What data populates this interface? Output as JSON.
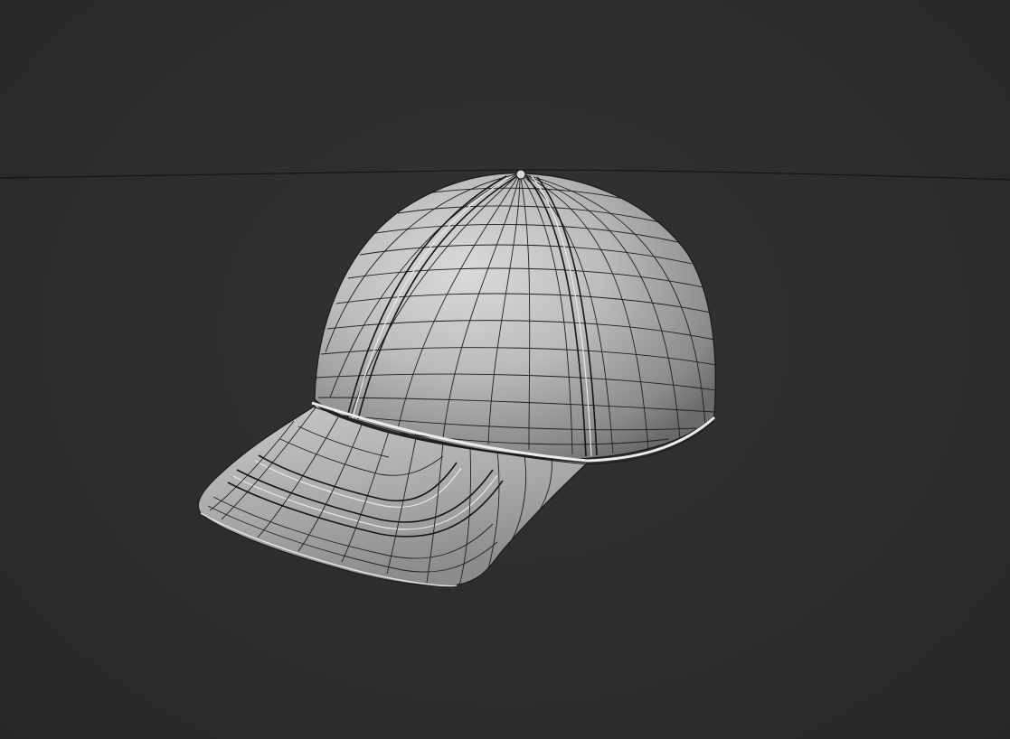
{
  "viewport": {
    "background_color": "#2d2d2d",
    "mesh_color": "#b9b9b9",
    "wire_color": "#1f1f1f"
  },
  "model": {
    "icon": "baseball-cap-mesh",
    "shading": "solid-with-wireframe"
  }
}
